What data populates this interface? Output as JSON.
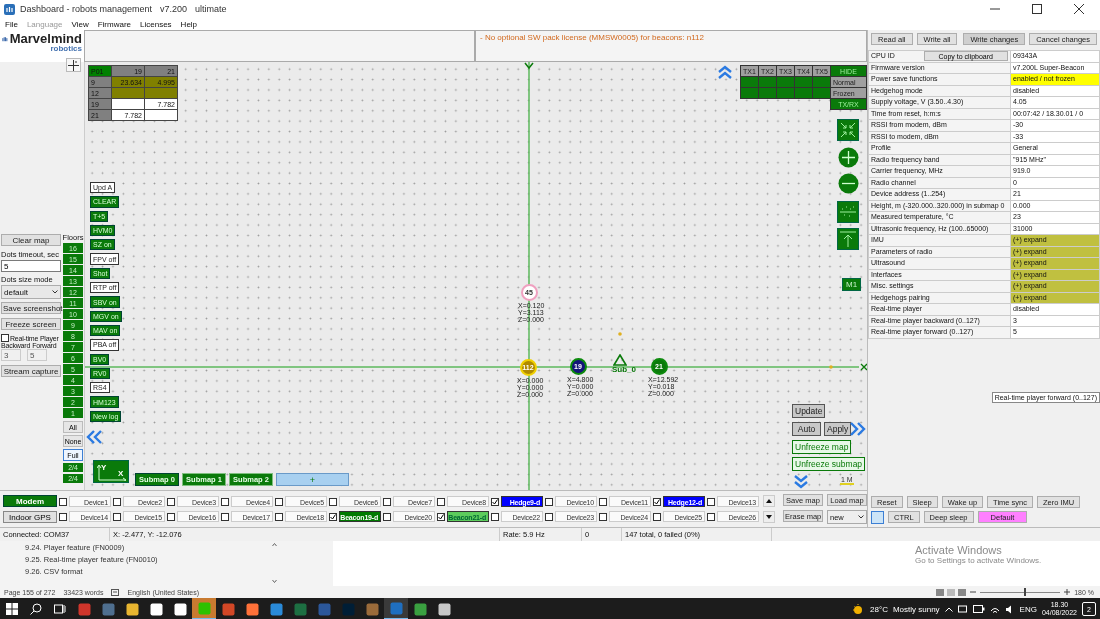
{
  "window": {
    "title": "Dashboard - robots management",
    "version": "v7.200",
    "edition": "ultimate"
  },
  "menu": [
    {
      "label": "File",
      "disabled": false
    },
    {
      "label": "Language",
      "disabled": true
    },
    {
      "label": "View",
      "disabled": false
    },
    {
      "label": "Firmware",
      "disabled": false
    },
    {
      "label": "Licenses",
      "disabled": false
    },
    {
      "label": "Help",
      "disabled": false
    }
  ],
  "logo": {
    "name": "Marvelmind",
    "tagline": "robotics"
  },
  "info": {
    "message": "- No optional SW pack license (MMSW0005) for beacons: n112"
  },
  "left_panel": {
    "clear_map": "Clear map",
    "dots_timeout": {
      "label": "Dots timeout, sec",
      "value": "5"
    },
    "dots_size": {
      "label": "Dots size mode",
      "value": "default"
    },
    "save_screenshot": "Save screenshot",
    "freeze_screen": "Freeze screen",
    "realtime_player": {
      "label": "Real-time Player",
      "checked": false
    },
    "player_fields": [
      {
        "label": "Backward",
        "value": "3"
      },
      {
        "label": "Forward",
        "value": "5"
      }
    ],
    "stream_capture": "Stream capture"
  },
  "floors": {
    "label": "Floors",
    "buttons": [
      "16",
      "15",
      "14",
      "13",
      "12",
      "11",
      "10",
      "9",
      "8",
      "7",
      "6",
      "5",
      "4",
      "3",
      "2",
      "1"
    ],
    "filters": [
      {
        "label": "All",
        "selected": false
      },
      {
        "label": "None",
        "selected": false
      },
      {
        "label": "Full",
        "selected": true
      }
    ],
    "pages": [
      "2/4",
      "2/4"
    ]
  },
  "map": {
    "distance_matrix": [
      [
        {
          "text": "P01",
          "color": "#008000"
        },
        {
          "text": "19",
          "color": "#808080"
        },
        {
          "text": "21",
          "color": "#808080"
        }
      ],
      [
        {
          "text": "9",
          "color": "#808080"
        },
        {
          "text": "23.634",
          "color": "#808000"
        },
        {
          "text": "4.995",
          "color": "#808000"
        }
      ],
      [
        {
          "text": "12",
          "color": "#808080"
        },
        {
          "color": "#808000"
        },
        {
          "color": "#808000"
        }
      ],
      [
        {
          "text": "19",
          "color": "#808080"
        },
        {
          "color": "#ffffff"
        },
        {
          "text": "7.782",
          "color": "#ffffff"
        }
      ],
      [
        {
          "text": "21",
          "color": "#808080"
        },
        {
          "text": "7.782",
          "color": "#ffffff"
        },
        {
          "color": "#ffffff"
        }
      ]
    ],
    "commands": [
      {
        "label": "Upd A",
        "on": false
      },
      {
        "label": "CLEAR",
        "on": true
      },
      {
        "label": "T+5",
        "on": true
      },
      {
        "label": "HVM0",
        "on": true
      },
      {
        "label": "SZ on",
        "on": true
      },
      {
        "label": "FPV off",
        "on": false
      },
      {
        "label": "Shot",
        "on": true
      },
      {
        "label": "RTP off",
        "on": false
      },
      {
        "label": "SBV on",
        "on": true
      },
      {
        "label": "MGV on",
        "on": true
      },
      {
        "label": "MAV on",
        "on": true
      },
      {
        "label": "PBA off",
        "on": false
      },
      {
        "label": "BV0",
        "on": true
      },
      {
        "label": "RV0",
        "on": true
      },
      {
        "label": "RS4",
        "on": false
      },
      {
        "label": "HM123",
        "on": true
      },
      {
        "label": "New log",
        "on": true
      }
    ],
    "tx_table": {
      "columns": [
        "TX1",
        "TX2",
        "TX3",
        "TX4",
        "TX5"
      ],
      "hide": "HIDE",
      "rows": [
        "Normal",
        "Frozen"
      ],
      "txrx": "TX/RX"
    },
    "marker": "M1",
    "nodes": [
      {
        "kind": "beacon",
        "label": "45",
        "coords": [
          "X=0.120",
          "Y=3.113",
          "Z=0.000"
        ],
        "color": "#ffffff"
      },
      {
        "kind": "beacon",
        "label": "112",
        "coords": [
          "X=0.000",
          "Y=0.000",
          "Z=0.000"
        ],
        "color": "#b08a00"
      },
      {
        "kind": "beacon",
        "label": "19",
        "coords": [
          "X=4.800",
          "Y=0.000",
          "Z=0.000"
        ],
        "color": "#14147a"
      },
      {
        "kind": "submap",
        "label": "Sub_0"
      },
      {
        "kind": "beacon",
        "label": "21",
        "coords": [
          "X=12.592",
          "Y=0.018",
          "Z=0.000"
        ],
        "color": "#0a7a0a"
      }
    ],
    "axes_labels": [
      "Y",
      "X"
    ],
    "submaps": [
      {
        "label": "Submap 0",
        "selected": true
      },
      {
        "label": "Submap 1",
        "selected": false
      },
      {
        "label": "Submap 2",
        "selected": false
      }
    ],
    "add_submap": "+",
    "actions": {
      "update": "Update",
      "auto": "Auto",
      "apply": "Apply",
      "unfreeze_map": "Unfreeze map",
      "unfreeze_submap": "Unfreeze submap"
    },
    "scale": "1 M"
  },
  "devices_bar": {
    "modes": [
      {
        "label": "Modem",
        "selected": true
      },
      {
        "label": "Indoor GPS",
        "selected": false
      }
    ],
    "devices": [
      {
        "label": "Device1",
        "checked": false
      },
      {
        "label": "Device2",
        "checked": false
      },
      {
        "label": "Device3",
        "checked": false
      },
      {
        "label": "Device4",
        "checked": false
      },
      {
        "label": "Device5",
        "checked": false
      },
      {
        "label": "Device6",
        "checked": false
      },
      {
        "label": "Device7",
        "checked": false
      },
      {
        "label": "Device8",
        "checked": false
      },
      {
        "label": "Hedge9-d",
        "checked": true,
        "color": "#0000ff"
      },
      {
        "label": "Device10",
        "checked": false
      },
      {
        "label": "Device11",
        "checked": false
      },
      {
        "label": "Hedge12-d",
        "checked": true,
        "color": "#0000ff"
      },
      {
        "label": "Device13",
        "checked": false
      },
      {
        "label": "Device14",
        "checked": false
      },
      {
        "label": "Device15",
        "checked": false
      },
      {
        "label": "Device16",
        "checked": false
      },
      {
        "label": "Device17",
        "checked": false
      },
      {
        "label": "Device18",
        "checked": false
      },
      {
        "label": "Beacon19-d",
        "checked": true,
        "color": "#007a00"
      },
      {
        "label": "Device20",
        "checked": false
      },
      {
        "label": "Beacon21-d",
        "checked": true,
        "color": "#5ccc5c"
      },
      {
        "label": "Device22",
        "checked": false
      },
      {
        "label": "Device23",
        "checked": false
      },
      {
        "label": "Device24",
        "checked": false
      },
      {
        "label": "Device25",
        "checked": false
      },
      {
        "label": "Device26",
        "checked": false
      }
    ],
    "save_map": "Save map",
    "load_map": "Load map",
    "erase_map": "Erase map",
    "map_select": "new"
  },
  "right_panel": {
    "buttons": [
      "Read all",
      "Write all",
      "Write changes",
      "Cancel changes"
    ],
    "rows": [
      {
        "label": "CPU ID",
        "button": "Copy to clipboard",
        "value": "09343A"
      },
      {
        "label": "Firmware version",
        "value": "v7.200L Super-Beacon"
      },
      {
        "label": "Power save functions",
        "value": "enabled / not frozen",
        "color": "#ffff00"
      },
      {
        "label": "Hedgehog mode",
        "value": "disabled"
      },
      {
        "label": "Supply voltage, V (3.50..4.30)",
        "value": "4.05"
      },
      {
        "label": "Time from reset, h:m:s",
        "value": "00:07:42 / 18.30.01 / 0"
      },
      {
        "label": "RSSI from modem, dBm",
        "value": "-30"
      },
      {
        "label": "RSSI to modem, dBm",
        "value": "-33"
      },
      {
        "label": "Profile",
        "value": "General"
      },
      {
        "label": "Radio frequency band",
        "value": "\"915 MHz\""
      },
      {
        "label": "Carrier frequency, MHz",
        "value": "919.0"
      },
      {
        "label": "Radio channel",
        "value": "0"
      },
      {
        "label": "Device address (1..254)",
        "value": "21"
      },
      {
        "label": "Height, m (-320.000..320.000) in submap 0",
        "value": "0.000"
      },
      {
        "label": "Measured temperature, °C",
        "value": "23"
      },
      {
        "label": "Ultrasonic frequency, Hz (100..65000)",
        "value": "31000"
      },
      {
        "label": "IMU",
        "value": "(+) expand",
        "color": "#c0c040"
      },
      {
        "label": "Parameters of radio",
        "value": "(+) expand",
        "color": "#c0c040"
      },
      {
        "label": "Ultrasound",
        "value": "(+) expand",
        "color": "#c0c040"
      },
      {
        "label": "Interfaces",
        "value": "(+) expand",
        "color": "#c0c040"
      },
      {
        "label": "Misc. settings",
        "value": "(+) expand",
        "color": "#c0c040"
      },
      {
        "label": "Hedgehogs pairing",
        "value": "(+) expand",
        "color": "#c0c040"
      },
      {
        "label": "Real-time player",
        "value": "disabled"
      },
      {
        "label": "Real-time player backward (0..127)",
        "value": "3"
      },
      {
        "label": "Real-time player forward (0..127)",
        "value": "5"
      }
    ],
    "tooltip": "Real-time player forward (0..127)",
    "actions": [
      {
        "label": "Reset"
      },
      {
        "label": "Sleep"
      },
      {
        "label": "Wake up"
      },
      {
        "label": "Time sync"
      },
      {
        "label": "Zero IMU"
      }
    ],
    "actions2": [
      {
        "label": "CTRL"
      },
      {
        "label": "Deep sleep"
      },
      {
        "label": "Default",
        "color": "#ff80ff"
      }
    ]
  },
  "status_bar": [
    "Connected: COM37",
    "X: -2.477, Y: -12.076",
    "Rate: 5.9 Hz",
    "0",
    "147 total, 0 failed (0%)"
  ],
  "document": {
    "nav": [
      "9.24. Player feature (FN0009)",
      "9.25. Real-time player feature (FN0010)",
      "9.26. CSV format"
    ],
    "activation": {
      "title": "Activate Windows",
      "text": "Go to Settings to activate Windows."
    },
    "status": {
      "page": "Page 155 of 272",
      "words": "33423 words",
      "language": "English (United States)",
      "zoom": "180 %",
      "level": 0.55
    }
  },
  "taskbar": {
    "apps": [
      {
        "selected": false
      },
      {
        "selected": false
      },
      {
        "selected": false
      },
      {
        "selected": false
      },
      {
        "selected": false
      },
      {
        "selected": true
      },
      {
        "selected": false
      },
      {
        "selected": false
      },
      {
        "selected": false
      },
      {
        "selected": false
      },
      {
        "selected": false
      },
      {
        "selected": false
      },
      {
        "selected": false
      },
      {
        "selected": true
      },
      {
        "selected": false
      },
      {
        "selected": false
      }
    ],
    "temperature": "28°C",
    "weather": "Mostly sunny",
    "language": "ENG",
    "time": "18.30",
    "date": "04/08/2022",
    "notifications": "2"
  }
}
